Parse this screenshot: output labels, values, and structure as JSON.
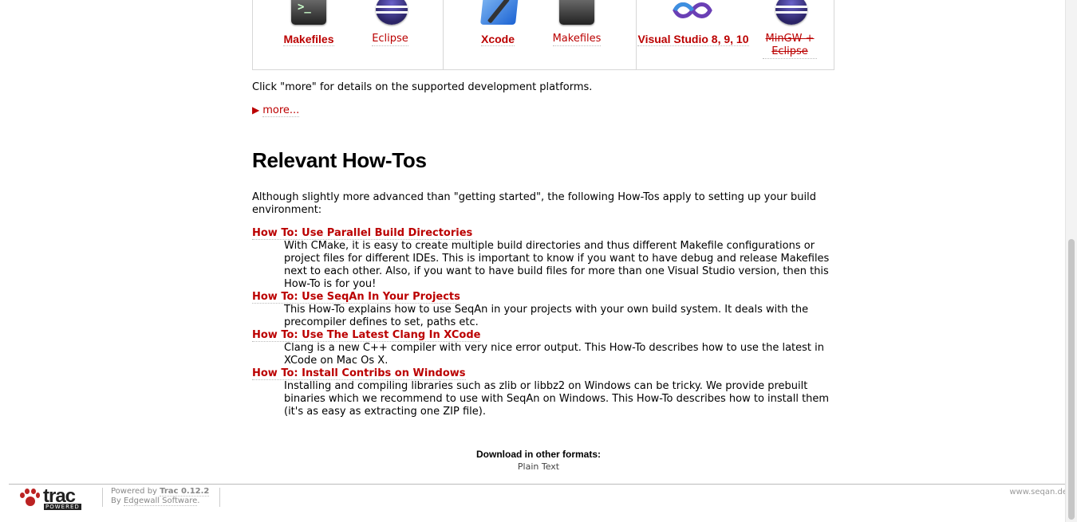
{
  "platforms": {
    "linux_makefiles": "Makefiles",
    "linux_eclipse": "Eclipse",
    "mac_xcode": "Xcode",
    "mac_makefiles": "Makefiles",
    "win_vs": "Visual Studio 8, 9, 10",
    "win_mingw": "MinGW + Eclipse"
  },
  "intro_more": "Click \"more\" for details on the supported development platforms.",
  "more_link": "more...",
  "section_title": "Relevant How-Tos",
  "section_intro": "Although slightly more advanced than \"getting started\", the following How-Tos apply to setting up your build environment:",
  "howtos": [
    {
      "title": "How To: Use Parallel Build Directories",
      "desc": "With CMake, it is easy to create multiple build directories and thus different Makefile configurations or project files for different IDEs. This is important to know if you want to have debug and release Makefiles next to each other. Also, if you want to have build files for more than one Visual Studio version, then this How-To is for you!"
    },
    {
      "title": "How To: Use SeqAn In Your Projects",
      "desc": "This How-To explains how to use SeqAn in your projects with your own build system. It deals with the precompiler defines to set, paths etc."
    },
    {
      "title": "How To: Use The Latest Clang In XCode",
      "desc": "Clang is a new C++ compiler with very nice error output. This How-To describes how to use the latest in XCode on Mac Os X."
    },
    {
      "title": "How To: Install Contribs on Windows",
      "desc": "Installing and compiling libraries such as zlib or libbz2 on Windows can be tricky. We provide prebuilt binaries which we recommend to use with SeqAn on Windows. This How-To describes how to install them (it's as easy as extracting one ZIP file)."
    }
  ],
  "download": {
    "heading": "Download in other formats:",
    "plain_text": "Plain Text"
  },
  "footer": {
    "trac_word": "trac",
    "trac_powered": "POWERED",
    "powered_by": "Powered by ",
    "trac_version": "Trac 0.12.2",
    "by": "By ",
    "edgewall": "Edgewall Software",
    "period": ".",
    "site": "www.seqan.de"
  },
  "icons": {
    "terminal": "terminal-icon",
    "eclipse": "eclipse-icon",
    "xcode": "xcode-icon",
    "visual_studio": "visual-studio-icon",
    "trac_paw": "trac-paw-icon",
    "more_triangle": "triangle-right-icon"
  },
  "colors": {
    "link": "#bb0000",
    "border": "#d7d7d7"
  }
}
